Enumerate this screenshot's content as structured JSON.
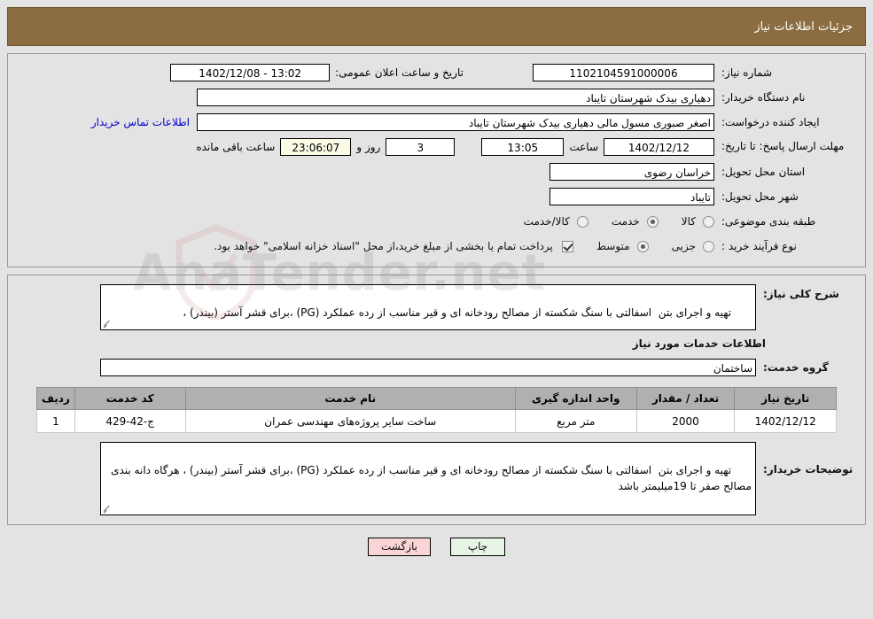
{
  "header": {
    "title": "جزئیات اطلاعات نیاز"
  },
  "need_info": {
    "need_no_label": "شماره نیاز:",
    "need_no_value": "1102104591000006",
    "public_announce_label": "تاریخ و ساعت اعلان عمومی:",
    "public_announce_value": "13:02 - 1402/12/08",
    "buyer_org_label": "نام دستگاه خریدار:",
    "buyer_org_value": "دهیاری بیدک  شهرستان تایباد",
    "requester_label": "ایجاد کننده درخواست:",
    "requester_value": "اصغر صبوری مسول مالی دهیاری بیدک  شهرستان تایباد",
    "buyer_contact_link": "اطلاعات تماس خریدار",
    "deadline_label": "مهلت ارسال پاسخ: تا تاریخ:",
    "deadline_date": "1402/12/12",
    "hour_label": "ساعت",
    "deadline_time": "13:05",
    "days_remaining": "3",
    "days_and_label": "روز و",
    "countdown": "23:06:07",
    "remaining_label": "ساعت باقی مانده",
    "province_label": "استان محل تحویل:",
    "province_value": "خراسان رضوی",
    "city_label": "شهر محل تحویل:",
    "city_value": "تایباد",
    "category_label": "طبقه بندی موضوعی:",
    "category_options": [
      {
        "label": "کالا",
        "selected": false
      },
      {
        "label": "خدمت",
        "selected": true
      },
      {
        "label": "کالا/خدمت",
        "selected": false
      }
    ],
    "process_label": "نوع فرآیند خرید :",
    "process_options": [
      {
        "label": "جزیی",
        "selected": false
      },
      {
        "label": "متوسط",
        "selected": true
      }
    ],
    "treasury_checkbox_checked": true,
    "treasury_text": "پرداخت تمام یا بخشی از مبلغ خرید،از محل \"اسناد خزانه اسلامی\" خواهد بود."
  },
  "details": {
    "general_desc_label": "شرح کلی نیاز:",
    "general_desc_value": "تهیه و اجرای بتن  اسفالتی با سنگ شکسته از مصالح رودخانه ای و قیر مناسب از رده عملکرد (PG) ،برای قشر آستر (بیندر) ،",
    "services_section_title": "اطلاعات خدمات مورد نیاز",
    "service_group_label": "گروه خدمت:",
    "service_group_value": "ساختمان",
    "buyer_notes_label": "توضیحات خریدار:",
    "buyer_notes_value": "تهیه و اجرای بتن  اسفالتی با سنگ شکسته از مصالح رودخانه ای و قیر مناسب از رده عملکرد (PG) ،برای قشر آستر (بیندر) ، هرگاه دانه بندی مصالح صفر تا 19میلیمتر باشد"
  },
  "table": {
    "headers": {
      "radif": "ردیف",
      "code": "کد خدمت",
      "name": "نام خدمت",
      "unit": "واحد اندازه گیری",
      "qty": "تعداد / مقدار",
      "date": "تاریخ نیاز"
    },
    "rows": [
      {
        "radif": "1",
        "code": "ج-42-429",
        "name": "ساخت سایر پروژه‌های مهندسی عمران",
        "unit": "متر مربع",
        "qty": "2000",
        "date": "1402/12/12"
      }
    ]
  },
  "footer": {
    "print_label": "چاپ",
    "back_label": "بازگشت"
  },
  "watermark": {
    "text": "AnaTender.net"
  },
  "colors": {
    "header_brown": "#8c6d41",
    "page_bg": "#e3e3e3",
    "link_blue": "#0000cc",
    "table_header_gray": "#b0b0b0",
    "print_button_green": "#e7f5e4",
    "back_button_pink": "#fbd5d5",
    "countdown_cream": "#fbfbe8"
  }
}
